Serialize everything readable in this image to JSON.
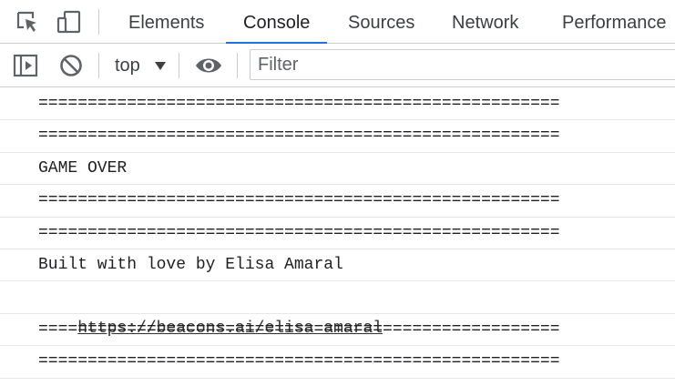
{
  "tabs": [
    {
      "label": "Elements",
      "active": false
    },
    {
      "label": "Console",
      "active": true
    },
    {
      "label": "Sources",
      "active": false
    },
    {
      "label": "Network",
      "active": false
    },
    {
      "label": "Performance",
      "active": false
    }
  ],
  "toolbar": {
    "context": "top",
    "filter_placeholder": "Filter",
    "filter_value": ""
  },
  "icons": {
    "inspect": "inspect-element-icon",
    "device": "device-toolbar-icon",
    "sidebar": "show-sidebar-icon",
    "clear": "clear-console-icon",
    "eye": "live-expression-icon"
  },
  "colors": {
    "accent": "#1a73e8",
    "border": "#cbcdd1",
    "icon": "#5f6368"
  },
  "messages": [
    {
      "text": "=====================================================",
      "link": false
    },
    {
      "text": "=====================================================",
      "link": false
    },
    {
      "text": "GAME OVER",
      "link": false
    },
    {
      "text": "=====================================================",
      "link": false
    },
    {
      "text": "=====================================================",
      "link": false
    },
    {
      "text": "Built with love by Elisa Amaral",
      "link": false
    },
    {
      "text": "https://beacons.ai/elisa_amaral",
      "link": true
    },
    {
      "text": "=====================================================",
      "link": false
    },
    {
      "text": "=====================================================",
      "link": false
    }
  ]
}
